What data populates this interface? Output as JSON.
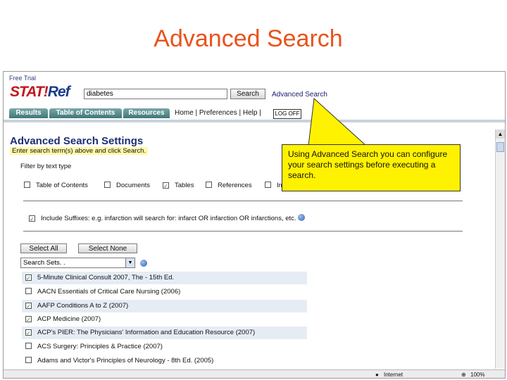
{
  "slide": {
    "title": "Advanced Search"
  },
  "header": {
    "free_trial": "Free Trial",
    "logo_a": "STAT!",
    "logo_b": "Ref",
    "search_value": "diabetes",
    "search_button": "Search",
    "advanced_link": "Advanced Search"
  },
  "tabs": [
    {
      "label": "Results"
    },
    {
      "label": "Table of Contents"
    },
    {
      "label": "Resources"
    }
  ],
  "nav": {
    "links": "Home | Preferences | Help |",
    "logoff": "LOG OFF"
  },
  "settings": {
    "title": "Advanced Search Settings",
    "hint": "Enter search term(s) above and click Search.",
    "filter_label": "Filter by text type",
    "filters": [
      {
        "label": "Table of Contents",
        "checked": false
      },
      {
        "label": "Documents",
        "checked": false
      },
      {
        "label": "Tables",
        "checked": true
      },
      {
        "label": "References",
        "checked": false
      },
      {
        "label": "Im",
        "checked": false
      }
    ],
    "suffixes_label": "Include Suffixes: e.g. infarction will search for: infarct OR infarction OR infarctions, etc.",
    "suffixes_checked": true,
    "select_all": "Select All",
    "select_none": "Select None",
    "search_sets": "Search Sets. ."
  },
  "books": [
    {
      "title": "5-Minute Clinical Consult 2007, The - 15th Ed.",
      "checked": true
    },
    {
      "title": "AACN Essentials of Critical Care Nursing (2006)",
      "checked": false
    },
    {
      "title": "AAFP Conditions A to Z (2007)",
      "checked": true
    },
    {
      "title": "ACP Medicine (2007)",
      "checked": true
    },
    {
      "title": "ACP's PIER: The Physicians' Information and Education Resource (2007)",
      "checked": true
    },
    {
      "title": "ACS Surgery: Principles & Practice (2007)",
      "checked": false
    },
    {
      "title": "Adams and Victor's Principles of Neurology - 8th Ed. (2005)",
      "checked": false
    }
  ],
  "statusbar": {
    "zone": "Internet",
    "zoom": "100%"
  },
  "callout": {
    "text": "Using Advanced Search you can configure your search settings before executing a search."
  },
  "colors": {
    "title": "#e8531c",
    "callout": "#fff200",
    "tab": "#3f7778",
    "heading": "#1c2f73"
  }
}
